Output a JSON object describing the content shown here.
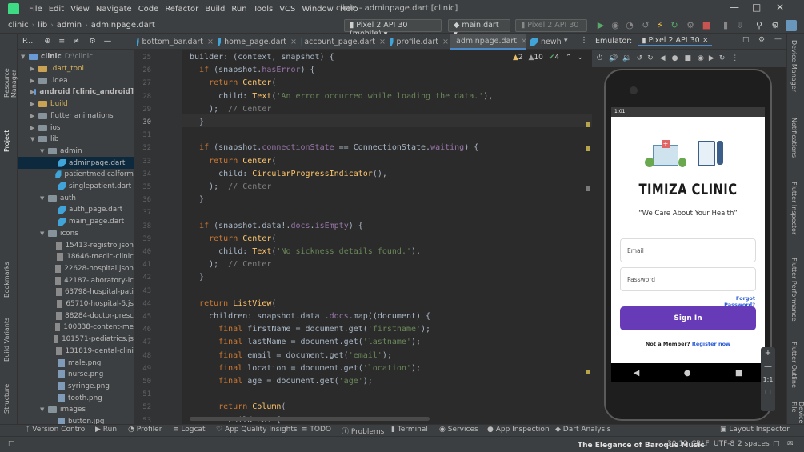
{
  "window": {
    "title": "clinic - adminpage.dart [clinic]",
    "menu": [
      "File",
      "Edit",
      "View",
      "Navigate",
      "Code",
      "Refactor",
      "Build",
      "Run",
      "Tools",
      "VCS",
      "Window",
      "Help"
    ]
  },
  "navbar": {
    "breadcrumbs": [
      "clinic",
      "lib",
      "admin",
      "adminpage.dart"
    ],
    "device_combo": "Pixel 2 API 30 (mobile)",
    "run_config": "main.dart",
    "device_dim": "Pixel 2 API 30"
  },
  "left_stripe": {
    "resource_manager": "Resource Manager",
    "project": "Project",
    "bookmarks": "Bookmarks",
    "build_variants": "Build Variants",
    "structure": "Structure"
  },
  "right_stripe": {
    "device_manager": "Device Manager",
    "notifications": "Notifications",
    "flutter_inspector": "Flutter Inspector",
    "flutter_performance": "Flutter Performance",
    "flutter_outline": "Flutter Outline",
    "device_file": "Device File"
  },
  "project": {
    "header": "P...",
    "items": [
      {
        "label": "clinic",
        "extra": "D:\\clinic",
        "kind": "root"
      },
      {
        "label": ".dart_tool",
        "kind": "folder-orange"
      },
      {
        "label": ".idea",
        "kind": "folder"
      },
      {
        "label": "android [clinic_android]",
        "kind": "folder-blue"
      },
      {
        "label": "build",
        "kind": "folder-orange"
      },
      {
        "label": "flutter animations",
        "kind": "folder"
      },
      {
        "label": "ios",
        "kind": "folder"
      },
      {
        "label": "lib",
        "kind": "folder"
      },
      {
        "label": "admin",
        "kind": "folder"
      },
      {
        "label": "adminpage.dart",
        "kind": "dart"
      },
      {
        "label": "patientmedicalform",
        "kind": "dart"
      },
      {
        "label": "singlepatient.dart",
        "kind": "dart"
      },
      {
        "label": "auth",
        "kind": "folder"
      },
      {
        "label": "auth_page.dart",
        "kind": "dart"
      },
      {
        "label": "main_page.dart",
        "kind": "dart"
      },
      {
        "label": "icons",
        "kind": "folder"
      },
      {
        "label": "15413-registro.json",
        "kind": "json"
      },
      {
        "label": "18646-medic-clinic",
        "kind": "json"
      },
      {
        "label": "22628-hospital.json",
        "kind": "json"
      },
      {
        "label": "42187-laboratory-ic",
        "kind": "json"
      },
      {
        "label": "63798-hospital-pati",
        "kind": "json"
      },
      {
        "label": "65710-hospital-5.js",
        "kind": "json"
      },
      {
        "label": "88284-doctor-presc",
        "kind": "json"
      },
      {
        "label": "100838-content-me",
        "kind": "json"
      },
      {
        "label": "101571-pediatrics.js",
        "kind": "json"
      },
      {
        "label": "131819-dental-clini",
        "kind": "json"
      },
      {
        "label": "male.png",
        "kind": "png"
      },
      {
        "label": "nurse.png",
        "kind": "png"
      },
      {
        "label": "syringe.png",
        "kind": "png"
      },
      {
        "label": "tooth.png",
        "kind": "png"
      },
      {
        "label": "images",
        "kind": "folder"
      },
      {
        "label": "button.jpg",
        "kind": "png"
      }
    ]
  },
  "tabs": [
    "bottom_bar.dart",
    "home_page.dart",
    "account_page.dart",
    "profile.dart",
    "adminpage.dart",
    "newh"
  ],
  "inspections": {
    "warnings": "2",
    "weak": "10",
    "typos": "4"
  },
  "editor": {
    "line_numbers": [
      "25",
      "26",
      "27",
      "28",
      "29",
      "30",
      "31",
      "32",
      "33",
      "34",
      "35",
      "36",
      "37",
      "38",
      "39",
      "40",
      "41",
      "42",
      "43",
      "44",
      "45",
      "46",
      "47",
      "48",
      "49",
      "50",
      "51",
      "52",
      "53"
    ],
    "lines": [
      "builder: (context, snapshot) {",
      "  if (snapshot.hasError) {",
      "    return Center(",
      "      child: Text('An error occurred while loading the data.'),",
      "    );  // Center",
      "  }",
      "",
      "  if (snapshot.connectionState == ConnectionState.waiting) {",
      "    return Center(",
      "      child: CircularProgressIndicator(),",
      "    );  // Center",
      "  }",
      "",
      "  if (snapshot.data!.docs.isEmpty) {",
      "    return Center(",
      "      child: Text('No sickness details found.'),",
      "    );  // Center",
      "  }",
      "",
      "  return ListView(",
      "    children: snapshot.data!.docs.map((document) {",
      "      final firstName = document.get('firstname');",
      "      final lastName = document.get('lastname');",
      "      final email = document.get('email');",
      "      final location = document.get('location');",
      "      final age = document.get('age');",
      "",
      "      return Column(",
      "        children: ["
    ]
  },
  "emulator": {
    "label": "Emulator:",
    "device_tab": "Pixel 2 API 30",
    "status_time": "1:01",
    "app": {
      "title": "TIMIZA CLINIC",
      "tagline": "“We Care About Your Health”",
      "email_placeholder": "Email",
      "password_placeholder": "Password",
      "forgot": "Forgot Password?",
      "sign_in": "Sign In",
      "not_member": "Not a Member?",
      "register": "Register now",
      "accent": "#673ab7"
    },
    "zoom_label": "1:1"
  },
  "bottom_tools": [
    "Version Control",
    "Run",
    "Profiler",
    "Logcat",
    "App Quality Insights",
    "TODO",
    "Problems",
    "Terminal",
    "Services",
    "App Inspection",
    "Dart Analysis",
    "Layout Inspector"
  ],
  "status": {
    "position": "30:12",
    "line_sep": "CRLF",
    "encoding": "UTF-8",
    "indent": "2 spaces",
    "background_text": "The Elegance of Baroque Music"
  }
}
